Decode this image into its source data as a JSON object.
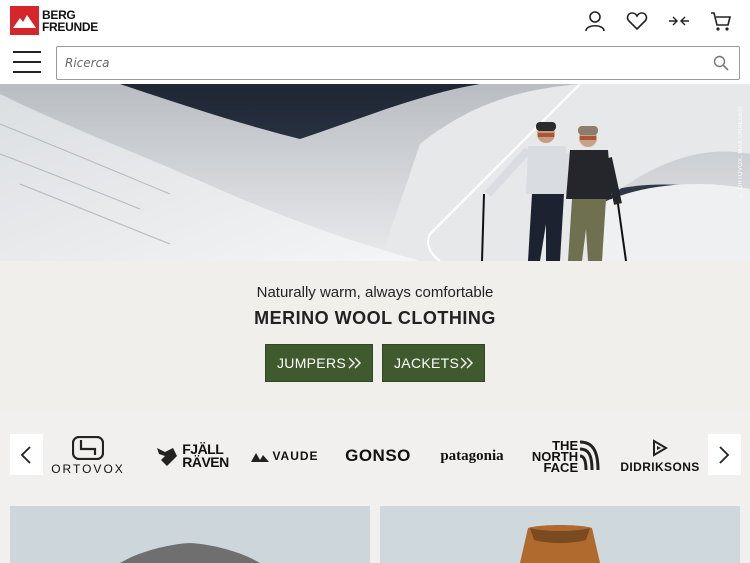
{
  "header": {
    "logo_line1": "BERG",
    "logo_line2": "FREUNDE",
    "icons": [
      "account-icon",
      "wishlist-icon",
      "compare-icon",
      "cart-icon"
    ]
  },
  "search": {
    "placeholder": "Ricerca"
  },
  "hero": {
    "photo_credit": "© ORTOVOX, MAX DRAEGER"
  },
  "promo": {
    "subline": "Naturally warm, always comfortable",
    "headline": "MERINO WOOL CLOTHING",
    "buttons": [
      {
        "label": "JUMPERS"
      },
      {
        "label": "JACKETS"
      }
    ],
    "button_color": "#3f5b2e"
  },
  "brands": {
    "items": [
      {
        "name": "ORTOVOX"
      },
      {
        "name": "FJÄLL"
      },
      {
        "name": "RÄVEN"
      },
      {
        "name": "VAUDE"
      },
      {
        "name": "GONSO"
      },
      {
        "name": "patagonia"
      },
      {
        "name": "THE"
      },
      {
        "name": "NORTH"
      },
      {
        "name": "FACE"
      },
      {
        "name": "DIDRIKSONS"
      }
    ]
  },
  "colors": {
    "brand_red": "#d6262c",
    "page_bg": "#f1f0ee"
  }
}
